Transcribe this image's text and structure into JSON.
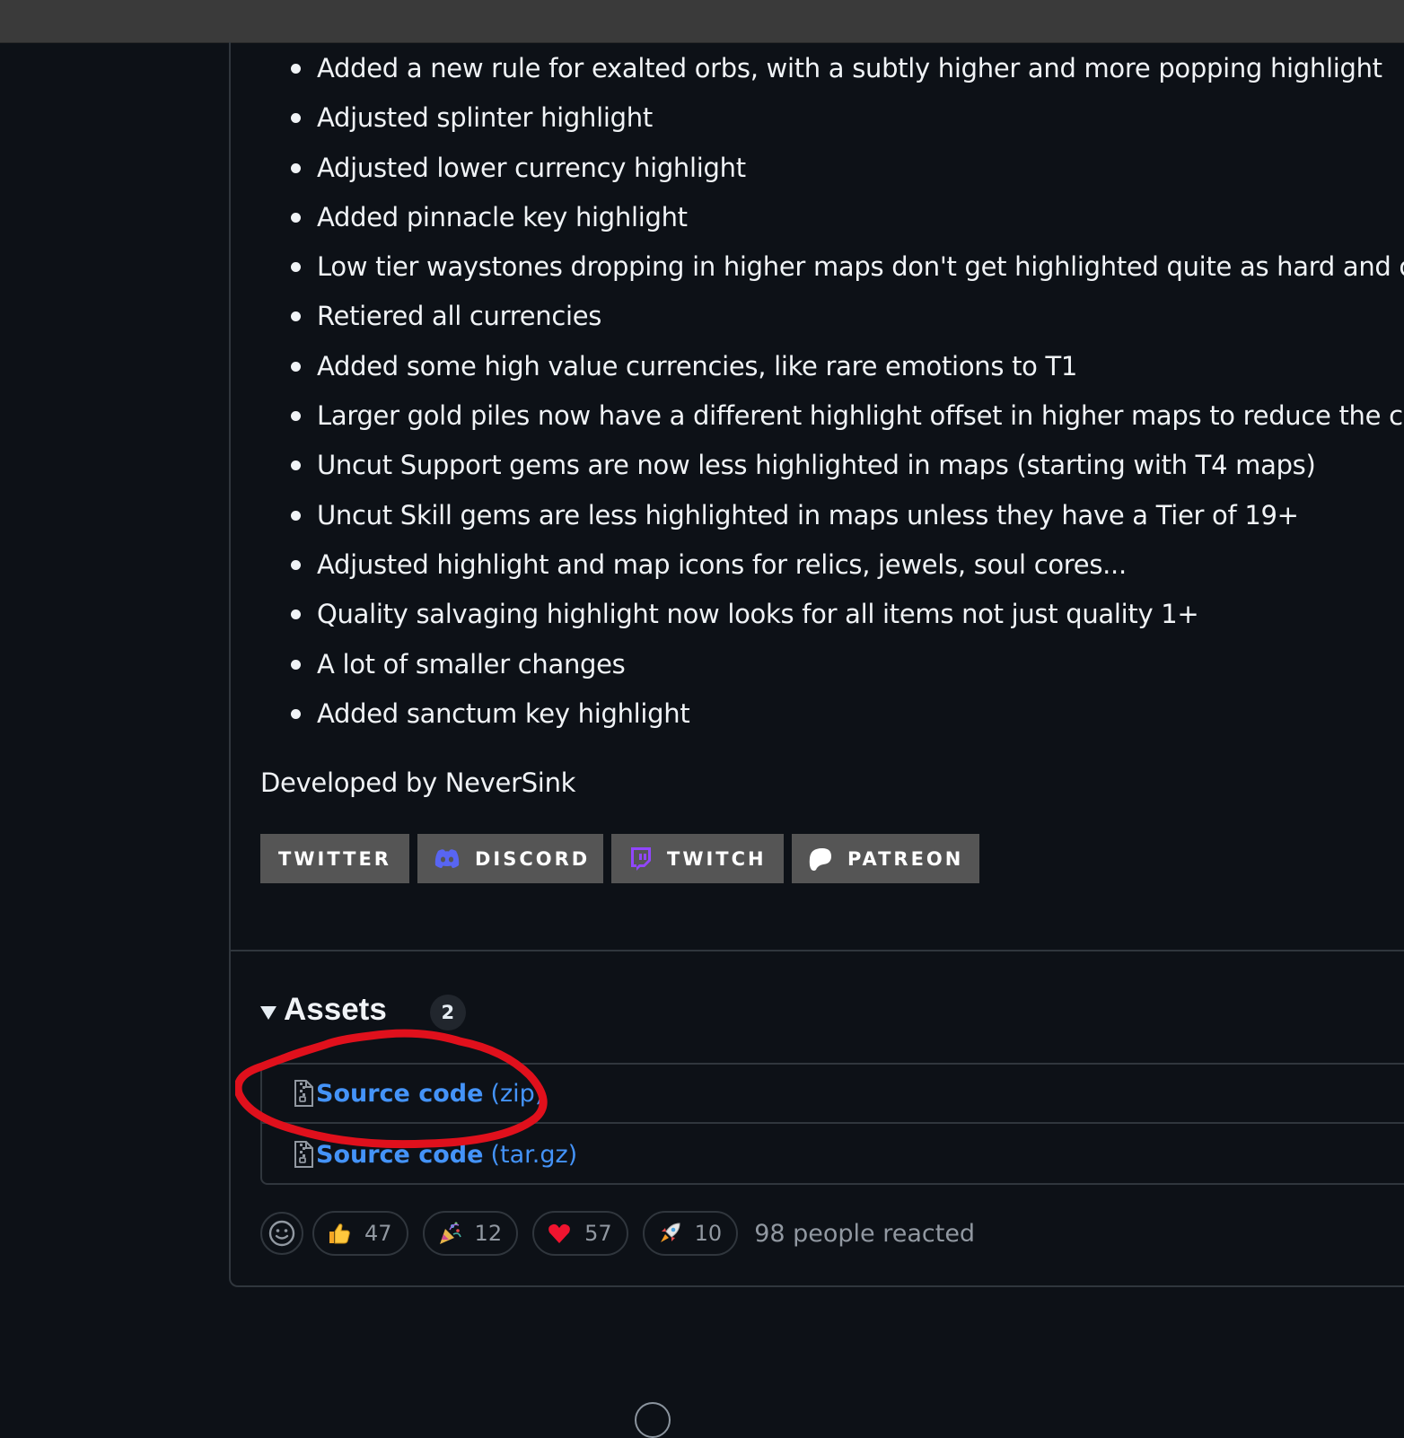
{
  "changelog": [
    "Added a new rule for exalted orbs, with a subtly higher and more popping highlight",
    "Adjusted splinter highlight",
    "Adjusted lower currency highlight",
    "Added pinnacle key highlight",
    "Low tier waystones dropping in higher maps don't get highlighted quite as hard and c",
    "Retiered all currencies",
    "Added some high value currencies, like rare emotions to T1",
    "Larger gold piles now have a different highlight offset in higher maps to reduce the co",
    "Uncut Support gems are now less highlighted in maps (starting with T4 maps)",
    "Uncut Skill gems are less highlighted in maps unless they have a Tier of 19+",
    "Adjusted highlight and map icons for relics, jewels, soul cores...",
    "Quality salvaging highlight now looks for all items not just quality 1+",
    "A lot of smaller changes",
    "Added sanctum key highlight"
  ],
  "developed_by": "Developed by NeverSink",
  "social": {
    "twitter": "TWITTER",
    "discord": "DISCORD",
    "twitch": "TWITCH",
    "patreon": "PATREON"
  },
  "assets": {
    "title": "Assets",
    "count": "2",
    "items": [
      {
        "name": "Source code",
        "ext": "(zip)",
        "icon": "file-zip-icon"
      },
      {
        "name": "Source code",
        "ext": "(tar.gz)",
        "icon": "file-zip-icon"
      }
    ]
  },
  "reactions": {
    "items": [
      {
        "emoji": "thumbs-up-icon",
        "count": "47"
      },
      {
        "emoji": "party-popper-icon",
        "count": "12"
      },
      {
        "emoji": "heart-icon",
        "count": "57"
      },
      {
        "emoji": "rocket-icon",
        "count": "10"
      }
    ],
    "summary": "98 people reacted"
  },
  "colors": {
    "background": "#0d1117",
    "link": "#4493f8",
    "border": "#30363d",
    "badge": "#555555",
    "annotation": "#e0101c"
  }
}
